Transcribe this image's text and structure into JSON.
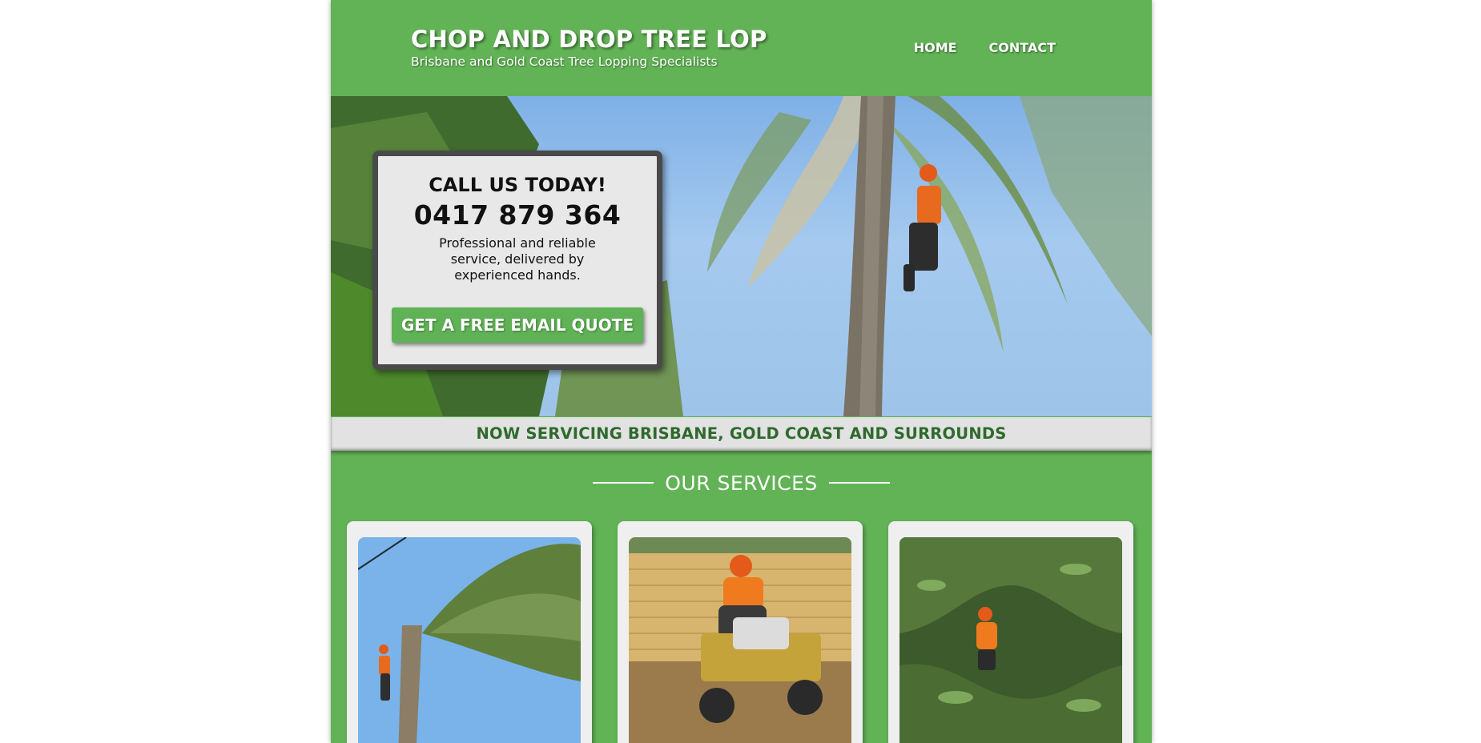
{
  "header": {
    "title": "CHOP AND DROP TREE LOP",
    "subtitle": "Brisbane and Gold Coast Tree Lopping Specialists",
    "nav": [
      {
        "label": "HOME"
      },
      {
        "label": "CONTACT"
      }
    ]
  },
  "hero": {
    "heading": "CALL US TODAY!",
    "phone": "0417 879 364",
    "text": "Professional and reliable service, delivered by experienced hands.",
    "button_label": "GET A FREE EMAIL QUOTE"
  },
  "banner": {
    "text": "NOW SERVICING BRISBANE, GOLD COAST AND SURROUNDS"
  },
  "services": {
    "title": "OUR SERVICES",
    "cards": [
      {
        "image": "palm-tree-climber-photo"
      },
      {
        "image": "stump-grinder-photo"
      },
      {
        "image": "tree-pruning-photo"
      }
    ]
  },
  "colors": {
    "brand_green": "#62b356",
    "button_green": "#5fb255",
    "banner_text": "#2e6a2c",
    "card_frame": "#4a4a4a"
  }
}
